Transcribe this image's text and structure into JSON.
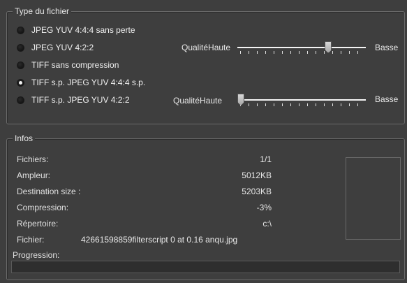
{
  "file_type": {
    "title": "Type du fichier",
    "options": [
      {
        "label": "JPEG YUV 4:4:4 sans perte",
        "checked": false
      },
      {
        "label": "JPEG YUV 4:2:2",
        "checked": false
      },
      {
        "label": "TIFF sans compression",
        "checked": false
      },
      {
        "label": "TIFF s.p. JPEG YUV 4:4:4 s.p.",
        "checked": true
      },
      {
        "label": "TIFF s.p. JPEG YUV 4:2:2",
        "checked": false
      }
    ],
    "quality_sliders": [
      {
        "label": "Qualité",
        "left_label": "Haute",
        "right_label": "Basse",
        "value": 0.72
      },
      {
        "label": "Qualité",
        "left_label": "Haute",
        "right_label": "Basse",
        "value": 0.0
      }
    ]
  },
  "infos": {
    "title": "Infos",
    "rows": [
      {
        "label": "Fichiers:",
        "value": "1/1"
      },
      {
        "label": "Ampleur:",
        "value": "5012KB"
      },
      {
        "label": "Destination size :",
        "value": "5203KB"
      },
      {
        "label": "Compression:",
        "value": "-3%"
      },
      {
        "label": "Répertoire:",
        "value": "c:\\"
      }
    ],
    "file_label": "Fichier:",
    "file_value": "42661598859filterscript 0 at 0.16 anqu.jpg",
    "progress_label": "Progression:",
    "progress": 0
  },
  "colors": {
    "background": "#3e3e3e",
    "progress_track": "#2e2e2e"
  }
}
